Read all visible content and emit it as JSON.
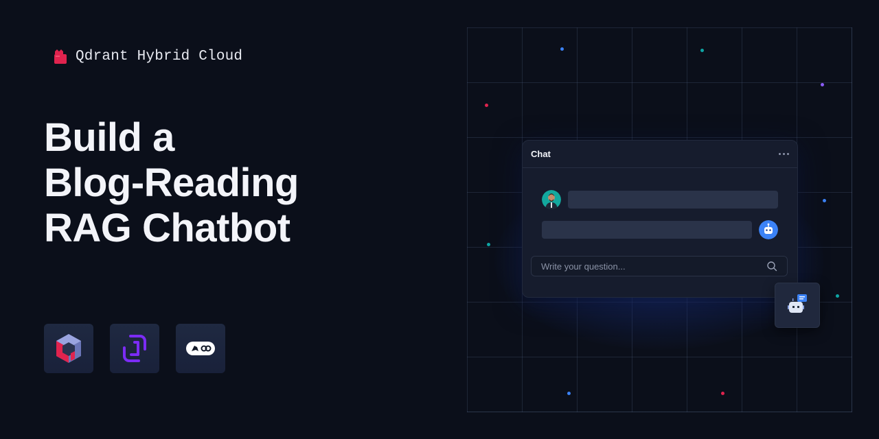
{
  "brand": {
    "name": "Qdrant Hybrid Cloud",
    "icon": "qdrant-cloud-icon",
    "color": "#e0234e"
  },
  "headline": {
    "line1": "Build a",
    "line2": "Blog-Reading",
    "line3": "RAG Chatbot"
  },
  "logos": [
    {
      "icon": "qdrant-logo-icon"
    },
    {
      "icon": "scaleway-logo-icon",
      "color": "#7b2cf5"
    },
    {
      "icon": "langchain-logo-icon"
    }
  ],
  "chat": {
    "title": "Chat",
    "menu_icon": "more-horizontal-icon",
    "input_placeholder": "Write your question...",
    "search_icon": "search-icon"
  },
  "colors": {
    "background": "#0b0f1a",
    "accent_blue": "#3b82f6",
    "accent_red": "#e0234e",
    "accent_teal": "#0ea5a4",
    "accent_purple": "#8b5cf6"
  }
}
